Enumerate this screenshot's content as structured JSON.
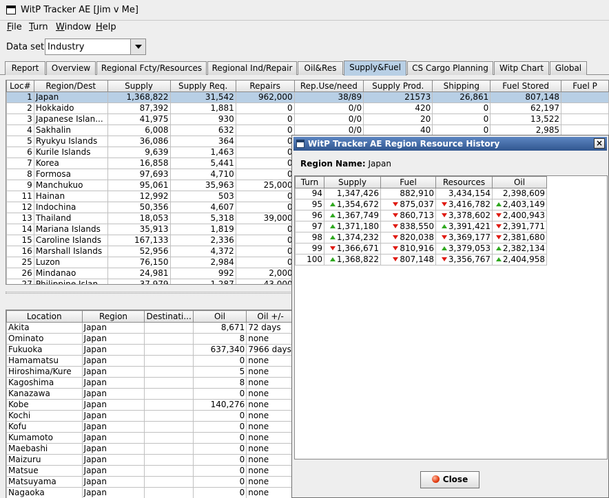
{
  "window": {
    "title": "WitP Tracker AE [Jim v Me]"
  },
  "menu": [
    {
      "mnemonic": "F",
      "rest": "ile"
    },
    {
      "mnemonic": "T",
      "rest": "urn"
    },
    {
      "mnemonic": "W",
      "rest": "indow"
    },
    {
      "mnemonic": "H",
      "rest": "elp"
    }
  ],
  "dataset": {
    "label": "Data set:",
    "value": "Industry"
  },
  "tabs": [
    "Report",
    "Overview",
    "Regional Fcty/Resources",
    "Regional Ind/Repair",
    "Oil&Res",
    "Supply&Fuel",
    "CS Cargo Planning",
    "Witp Chart",
    "Global"
  ],
  "active_tab": "Supply&Fuel",
  "supply_table": {
    "columns": [
      "Loc#",
      "Region/Dest",
      "Supply",
      "Supply Req.",
      "Repairs",
      "Rep.Use/need",
      "Supply Prod.",
      "Shipping",
      "Fuel Stored",
      "Fuel P"
    ],
    "rows": [
      [
        "1",
        "Japan",
        "1,368,822",
        "31,542",
        "962,000",
        "38/89",
        "21573",
        "26,861",
        "807,148",
        ""
      ],
      [
        "2",
        "Hokkaido",
        "87,392",
        "1,881",
        "0",
        "0/0",
        "420",
        "0",
        "62,197",
        ""
      ],
      [
        "3",
        "Japanese Islan...",
        "41,975",
        "930",
        "0",
        "0/0",
        "20",
        "0",
        "13,522",
        ""
      ],
      [
        "4",
        "Sakhalin",
        "6,008",
        "632",
        "0",
        "0/0",
        "40",
        "0",
        "2,985",
        ""
      ],
      [
        "5",
        "Ryukyu Islands",
        "36,086",
        "364",
        "0",
        "",
        "",
        "",
        "",
        ""
      ],
      [
        "6",
        "Kurile Islands",
        "9,639",
        "1,463",
        "0",
        "",
        "",
        "",
        "",
        ""
      ],
      [
        "7",
        "Korea",
        "16,858",
        "5,441",
        "0",
        "",
        "",
        "",
        "",
        ""
      ],
      [
        "8",
        "Formosa",
        "97,693",
        "4,710",
        "0",
        "",
        "",
        "",
        "",
        ""
      ],
      [
        "9",
        "Manchukuo",
        "95,061",
        "35,963",
        "25,000",
        "",
        "",
        "",
        "",
        ""
      ],
      [
        "11",
        "Hainan",
        "12,992",
        "503",
        "0",
        "",
        "",
        "",
        "",
        ""
      ],
      [
        "12",
        "Indochina",
        "50,356",
        "4,607",
        "0",
        "",
        "",
        "",
        "",
        ""
      ],
      [
        "13",
        "Thailand",
        "18,053",
        "5,318",
        "39,000",
        "",
        "",
        "",
        "",
        ""
      ],
      [
        "14",
        "Mariana Islands",
        "35,913",
        "1,819",
        "0",
        "",
        "",
        "",
        "",
        ""
      ],
      [
        "15",
        "Caroline Islands",
        "167,133",
        "2,336",
        "0",
        "",
        "",
        "",
        "",
        ""
      ],
      [
        "16",
        "Marshall Islands",
        "52,956",
        "4,372",
        "0",
        "",
        "",
        "",
        "",
        ""
      ],
      [
        "25",
        "Luzon",
        "76,150",
        "2,984",
        "0",
        "",
        "",
        "",
        "",
        ""
      ],
      [
        "26",
        "Mindanao",
        "24,981",
        "992",
        "2,000",
        "",
        "",
        "",
        "",
        ""
      ],
      [
        "27",
        "Philippine Islan...",
        "37,979",
        "1,287",
        "43,000",
        "",
        "",
        "",
        "",
        ""
      ]
    ]
  },
  "location_table": {
    "columns": [
      "Location",
      "Region",
      "Destinati...",
      "Oil",
      "Oil +/-"
    ],
    "rows": [
      [
        "Akita",
        "Japan",
        "",
        "8,671",
        "72 days"
      ],
      [
        "Ominato",
        "Japan",
        "",
        "8",
        "none"
      ],
      [
        "Fukuoka",
        "Japan",
        "",
        "637,340",
        "7966 days"
      ],
      [
        "Hamamatsu",
        "Japan",
        "",
        "0",
        "none"
      ],
      [
        "Hiroshima/Kure",
        "Japan",
        "",
        "5",
        "none"
      ],
      [
        "Kagoshima",
        "Japan",
        "",
        "8",
        "none"
      ],
      [
        "Kanazawa",
        "Japan",
        "",
        "0",
        "none"
      ],
      [
        "Kobe",
        "Japan",
        "",
        "140,276",
        "none"
      ],
      [
        "Kochi",
        "Japan",
        "",
        "0",
        "none"
      ],
      [
        "Kofu",
        "Japan",
        "",
        "0",
        "none"
      ],
      [
        "Kumamoto",
        "Japan",
        "",
        "0",
        "none"
      ],
      [
        "Maebashi",
        "Japan",
        "",
        "0",
        "none"
      ],
      [
        "Maizuru",
        "Japan",
        "",
        "0",
        "none"
      ],
      [
        "Matsue",
        "Japan",
        "",
        "0",
        "none"
      ],
      [
        "Matsuyama",
        "Japan",
        "",
        "0",
        "none"
      ],
      [
        "Nagaoka",
        "Japan",
        "",
        "0",
        "none"
      ]
    ]
  },
  "dialog": {
    "title": "WitP Tracker AE Region Resource History",
    "region_label": "Region Name:",
    "region_value": "Japan",
    "columns": [
      "Turn",
      "Supply",
      "Fuel",
      "Resources",
      "Oil"
    ],
    "rows": [
      {
        "turn": "94",
        "supply": {
          "v": "1,347,426",
          "t": ""
        },
        "fuel": {
          "v": "882,910",
          "t": ""
        },
        "resources": {
          "v": "3,434,154",
          "t": ""
        },
        "oil": {
          "v": "2,398,609",
          "t": ""
        }
      },
      {
        "turn": "95",
        "supply": {
          "v": "1,354,672",
          "t": "up"
        },
        "fuel": {
          "v": "875,037",
          "t": "down"
        },
        "resources": {
          "v": "3,416,782",
          "t": "down"
        },
        "oil": {
          "v": "2,403,149",
          "t": "up"
        }
      },
      {
        "turn": "96",
        "supply": {
          "v": "1,367,749",
          "t": "up"
        },
        "fuel": {
          "v": "860,713",
          "t": "down"
        },
        "resources": {
          "v": "3,378,602",
          "t": "down"
        },
        "oil": {
          "v": "2,400,943",
          "t": "down"
        }
      },
      {
        "turn": "97",
        "supply": {
          "v": "1,371,180",
          "t": "up"
        },
        "fuel": {
          "v": "838,550",
          "t": "down"
        },
        "resources": {
          "v": "3,391,421",
          "t": "up"
        },
        "oil": {
          "v": "2,391,771",
          "t": "down"
        }
      },
      {
        "turn": "98",
        "supply": {
          "v": "1,374,232",
          "t": "up"
        },
        "fuel": {
          "v": "820,038",
          "t": "down"
        },
        "resources": {
          "v": "3,369,177",
          "t": "down"
        },
        "oil": {
          "v": "2,381,680",
          "t": "down"
        }
      },
      {
        "turn": "99",
        "supply": {
          "v": "1,366,671",
          "t": "down"
        },
        "fuel": {
          "v": "810,916",
          "t": "down"
        },
        "resources": {
          "v": "3,379,053",
          "t": "up"
        },
        "oil": {
          "v": "2,382,134",
          "t": "up"
        }
      },
      {
        "turn": "100",
        "supply": {
          "v": "1,368,822",
          "t": "up"
        },
        "fuel": {
          "v": "807,148",
          "t": "down"
        },
        "resources": {
          "v": "3,356,767",
          "t": "down"
        },
        "oil": {
          "v": "2,404,958",
          "t": "up"
        }
      }
    ],
    "close_label": "Close"
  }
}
